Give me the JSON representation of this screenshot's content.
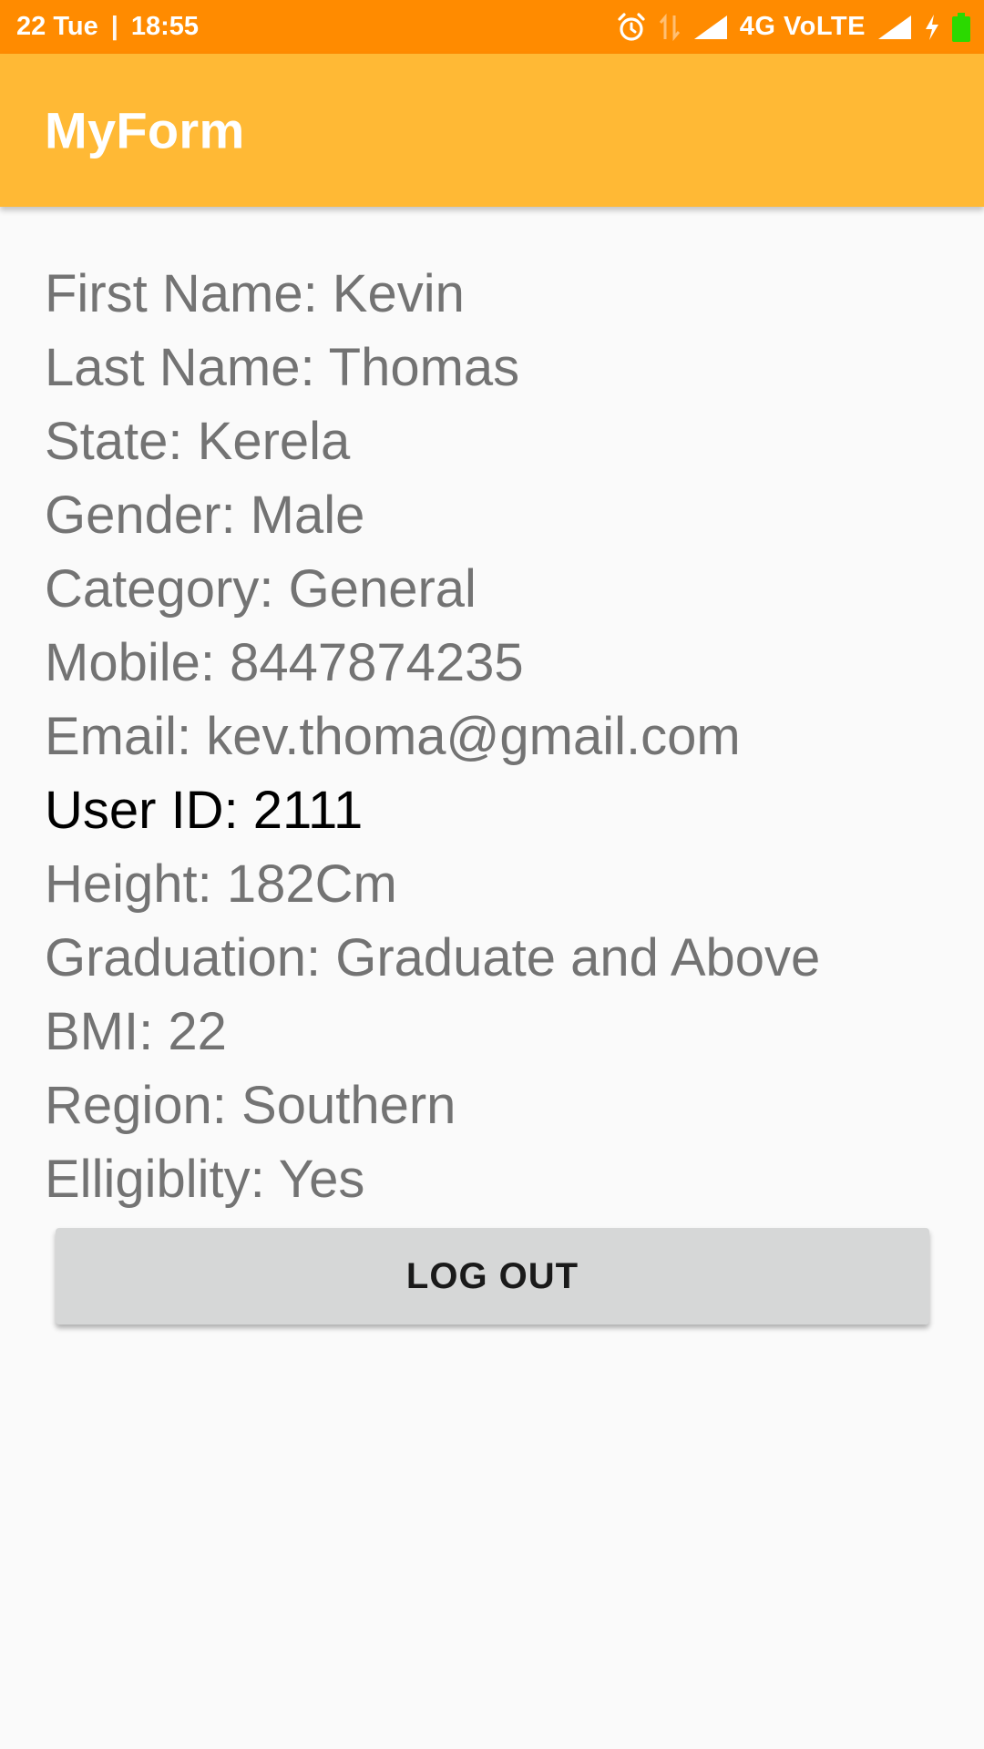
{
  "status_bar": {
    "date": "22 Tue",
    "separator": "|",
    "time": "18:55",
    "network": "4G VoLTE",
    "icons": [
      "alarm-icon",
      "data-transfer-icon",
      "signal-icon",
      "signal-icon",
      "charging-icon",
      "battery-icon"
    ],
    "battery_color": "#2bd900"
  },
  "app_bar": {
    "title": "MyForm",
    "color": "#ffb935"
  },
  "details": [
    {
      "label": "First Name: Kevin"
    },
    {
      "label": "Last Name: Thomas"
    },
    {
      "label": "State: Kerela"
    },
    {
      "label": "Gender: Male"
    },
    {
      "label": "Category: General"
    },
    {
      "label": "Mobile: 8447874235"
    },
    {
      "label": "Email: kev.thoma@gmail.com"
    },
    {
      "label": "User ID: 2111"
    },
    {
      "label": "Height: 182Cm"
    },
    {
      "label": "Graduation: Graduate and Above"
    },
    {
      "label": "BMI: 22"
    },
    {
      "label": "Region: Southern"
    },
    {
      "label": "Elligiblity: Yes"
    }
  ],
  "logout_button": {
    "label": "LOG OUT"
  },
  "colors": {
    "status_bar": "#ff8b00",
    "app_bar": "#ffb935",
    "text_gray": "#737373",
    "text_dark": "#000000",
    "button_bg": "#d6d7d7"
  }
}
